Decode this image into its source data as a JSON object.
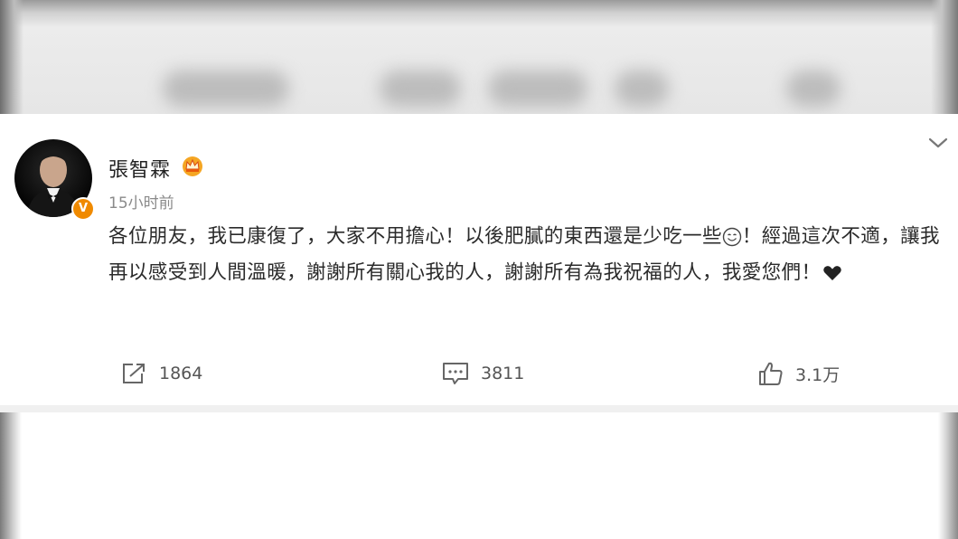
{
  "post": {
    "author": "張智霖",
    "timestamp": "15小时前",
    "text_part1": "各位朋友，我已康復了，大家不用擔心！以後肥膩的東西還是少吃一些",
    "text_part2": "！經過這次不適，讓我再以感受到人間溫暖，謝謝所有關心我的人，謝謝所有為我祝福的人，我愛您們！",
    "verified_badge": "V",
    "icons": [
      "crown-icon",
      "chevron-down-icon",
      "smile-emoji-icon",
      "heart-icon",
      "repost-icon",
      "comment-icon",
      "like-icon"
    ]
  },
  "actions": {
    "repost_count": "1864",
    "comment_count": "3811",
    "like_count": "3.1万"
  },
  "colors": {
    "verified": "#f08a00",
    "crown": "#f5a623",
    "text": "#2b2b2b",
    "meta": "#8a8a8a"
  }
}
